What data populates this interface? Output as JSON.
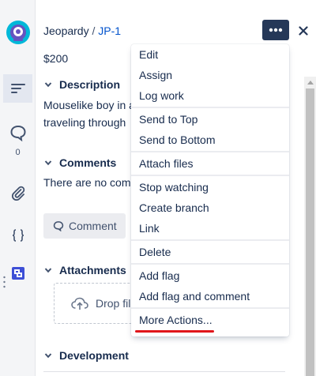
{
  "header": {
    "project": "Jeopardy",
    "separator": "/",
    "issue_key": "JP-1",
    "more_icon": "more-horizontal-icon",
    "close_icon": "close-icon"
  },
  "sidebar": {
    "items": [
      {
        "icon": "details-icon",
        "active": true
      },
      {
        "icon": "comment-icon",
        "count": "0"
      },
      {
        "icon": "attachment-icon"
      },
      {
        "icon": "code-braces-icon"
      },
      {
        "icon": "integration-icon"
      }
    ]
  },
  "issue": {
    "price": "$200",
    "description": {
      "heading": "Description",
      "lines": [
        "Mouselike boy in a",
        "traveling through"
      ]
    },
    "comments": {
      "heading": "Comments",
      "empty_text": "There are no comm",
      "button_label": "Comment"
    },
    "attachments": {
      "heading": "Attachments",
      "drop_label": "Drop file"
    },
    "development": {
      "heading": "Development"
    }
  },
  "menu": {
    "groups": [
      [
        "Edit",
        "Assign",
        "Log work"
      ],
      [
        "Send to Top",
        "Send to Bottom"
      ],
      [
        "Attach files"
      ],
      [
        "Stop watching",
        "Create branch",
        "Link"
      ],
      [
        "Delete"
      ],
      [
        "Add flag",
        "Add flag and comment"
      ],
      [
        "More Actions..."
      ]
    ]
  },
  "colors": {
    "accent": "#0052cc",
    "more_button_bg": "#253858",
    "annotation_underline": "#e0161b"
  }
}
